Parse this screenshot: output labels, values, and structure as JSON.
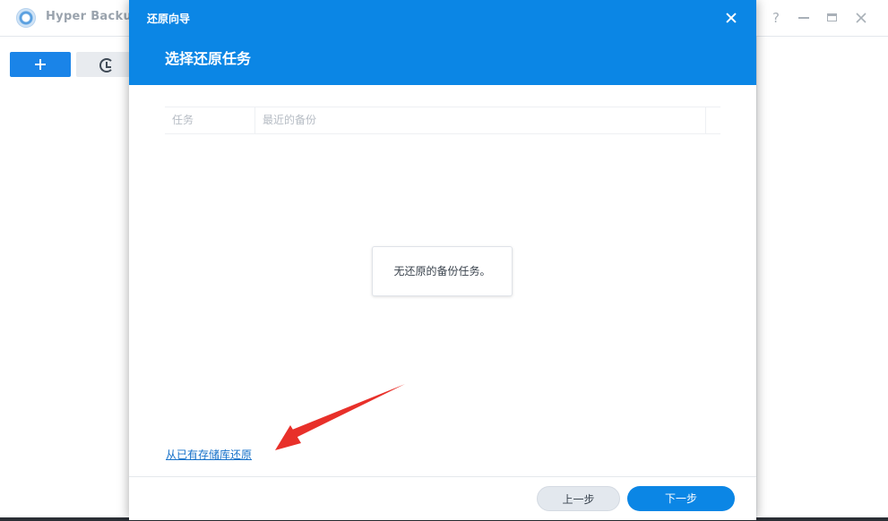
{
  "app": {
    "title": "Hyper Backup",
    "help_glyph": "?",
    "icons": [
      "hyper-backup-logo",
      "plus-icon",
      "history-icon",
      "help-icon",
      "minimize-icon",
      "maximize-icon",
      "close-icon"
    ]
  },
  "dialog": {
    "window_title": "还原向导",
    "heading": "选择还原任务",
    "table": {
      "columns": [
        "任务",
        "最近的备份"
      ]
    },
    "empty_message": "无还原的备份任务。",
    "restore_link": "从已有存储库还原",
    "buttons": {
      "prev": "上一步",
      "next": "下一步"
    }
  },
  "colors": {
    "accent": "#0b86e5",
    "link": "#1671c9",
    "annotation_arrow": "#e8302a"
  }
}
